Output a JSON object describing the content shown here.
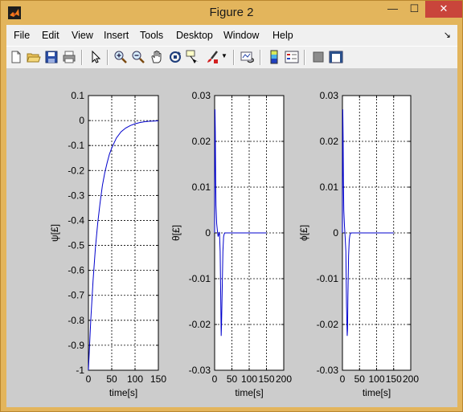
{
  "window": {
    "title": "Figure 2",
    "minimize_glyph": "—",
    "maximize_glyph": "☐",
    "close_glyph": "✕"
  },
  "menu": {
    "items": [
      {
        "label": "File"
      },
      {
        "label": "Edit"
      },
      {
        "label": "View"
      },
      {
        "label": "Insert"
      },
      {
        "label": "Tools"
      },
      {
        "label": "Desktop"
      },
      {
        "label": "Window"
      },
      {
        "label": "Help"
      }
    ],
    "dock_glyph": "↘"
  },
  "toolbar": {
    "icons": [
      "new-figure-icon",
      "open-file-icon",
      "save-icon",
      "print-icon",
      "edit-plot-arrow-icon",
      "zoom-in-icon",
      "zoom-out-icon",
      "pan-hand-icon",
      "rotate-3d-icon",
      "data-cursor-icon",
      "brush-icon",
      "brush-dropdown-icon",
      "link-plot-icon",
      "colorbar-icon",
      "legend-icon",
      "hide-plot-tools-icon",
      "show-plot-tools-icon"
    ]
  },
  "colors": {
    "title_bar": "#e3b55c",
    "close_button": "#c9453b",
    "figure_background": "#cccccc",
    "line": "#0000cc"
  },
  "chart_data": [
    {
      "type": "line",
      "title": "",
      "xlabel": "time[s]",
      "ylabel": "ψ[£]",
      "xlim": [
        0,
        150
      ],
      "ylim": [
        -1,
        0.1
      ],
      "xticks": [
        "0",
        "50",
        "100",
        "150"
      ],
      "yticks": [
        "0.1",
        "0",
        "-0.1",
        "-0.2",
        "-0.3",
        "-0.4",
        "-0.5",
        "-0.6",
        "-0.7",
        "-0.8",
        "-0.9",
        "-1"
      ],
      "grid": true,
      "series": [
        {
          "x": [
            0,
            5,
            10,
            15,
            20,
            25,
            30,
            35,
            40,
            45,
            50,
            60,
            70,
            80,
            90,
            100,
            110,
            120,
            130,
            140,
            150
          ],
          "y": [
            -1.0,
            -0.8,
            -0.64,
            -0.51,
            -0.41,
            -0.33,
            -0.26,
            -0.21,
            -0.17,
            -0.135,
            -0.11,
            -0.07,
            -0.045,
            -0.03,
            -0.02,
            -0.013,
            -0.008,
            -0.005,
            -0.003,
            -0.002,
            -0.001
          ]
        }
      ]
    },
    {
      "type": "line",
      "title": "",
      "xlabel": "time[s]",
      "ylabel": "θ[£]",
      "xlim": [
        0,
        200
      ],
      "ylim": [
        -0.03,
        0.03
      ],
      "xticks": [
        "0",
        "50",
        "100",
        "150",
        "200"
      ],
      "yticks": [
        "0.03",
        "0.02",
        "0.01",
        "0",
        "-0.01",
        "-0.02",
        "-0.03"
      ],
      "grid": true,
      "series": [
        {
          "x": [
            0,
            1,
            2,
            3,
            4,
            6,
            8,
            10,
            12,
            14,
            16,
            18,
            19,
            20,
            22,
            24,
            26,
            28,
            30,
            35,
            50,
            100,
            150
          ],
          "y": [
            0,
            0.027,
            0.022,
            0.012,
            0.006,
            0.002,
            0.0005,
            -0.0008,
            -0.0003,
            0.0002,
            -0.004,
            -0.016,
            -0.0225,
            -0.02,
            -0.012,
            -0.004,
            -0.0008,
            -0.0002,
            0,
            0,
            0,
            0,
            0
          ]
        }
      ]
    },
    {
      "type": "line",
      "title": "",
      "xlabel": "time[s]",
      "ylabel": "ϕ[£]",
      "xlim": [
        0,
        200
      ],
      "ylim": [
        -0.03,
        0.03
      ],
      "xticks": [
        "0",
        "50",
        "100",
        "150",
        "200"
      ],
      "yticks": [
        "0.03",
        "0.02",
        "0.01",
        "0",
        "-0.01",
        "-0.02",
        "-0.03"
      ],
      "grid": true,
      "series": [
        {
          "x": [
            0,
            1,
            2,
            3,
            4,
            6,
            8,
            10,
            12,
            14,
            15,
            16,
            18,
            20,
            22,
            25,
            30,
            50,
            100,
            150
          ],
          "y": [
            0,
            0.027,
            0.021,
            0.011,
            0.005,
            0.0015,
            -0.001,
            -0.004,
            -0.016,
            -0.0225,
            -0.021,
            -0.014,
            -0.005,
            -0.0015,
            -0.0004,
            0,
            0,
            0,
            0,
            0
          ]
        }
      ]
    }
  ]
}
